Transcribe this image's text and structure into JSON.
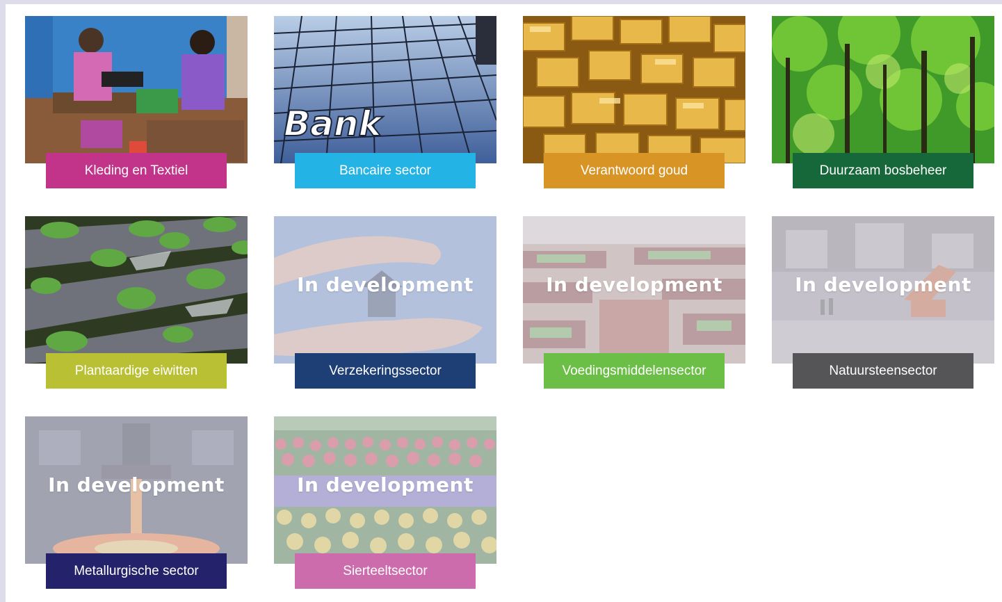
{
  "overlay_text": "In development",
  "sectors": [
    {
      "label": "Kleding en Textiel",
      "color": "#c1348a",
      "status": "active",
      "image": "textile-workers-photo"
    },
    {
      "label": "Bancaire sector",
      "color": "#24b3e5",
      "status": "active",
      "image": "bank-building-photo"
    },
    {
      "label": "Verantwoord goud",
      "color": "#d99426",
      "status": "active",
      "image": "gold-bars-photo"
    },
    {
      "label": "Duurzaam bosbeheer",
      "color": "#16683a",
      "status": "active",
      "image": "forest-photo"
    },
    {
      "label": "Plantaardige eiwitten",
      "color": "#b9c034",
      "status": "active",
      "image": "crop-rows-photo"
    },
    {
      "label": "Verzekeringssector",
      "color": "#1e3f75",
      "status": "in-development",
      "image": "hands-house-photo"
    },
    {
      "label": "Voedingsmiddelensector",
      "color": "#6cbf46",
      "status": "in-development",
      "image": "supermarket-photo"
    },
    {
      "label": "Natuursteensector",
      "color": "#555558",
      "status": "in-development",
      "image": "quarry-photo"
    },
    {
      "label": "Metallurgische sector",
      "color": "#23226b",
      "status": "in-development",
      "image": "steel-foundry-photo"
    },
    {
      "label": "Sierteeltsector",
      "color": "#cd6cad",
      "status": "in-development",
      "image": "tulip-field-photo"
    }
  ]
}
